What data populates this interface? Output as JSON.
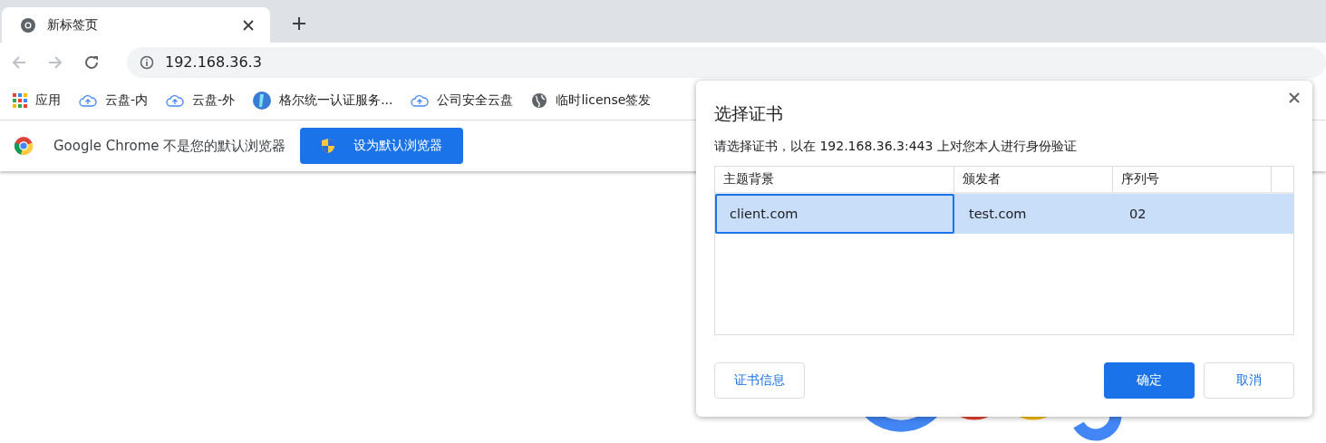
{
  "tabs": [
    {
      "title": "新标签页",
      "selected": true
    }
  ],
  "address_bar": {
    "url": "192.168.36.3"
  },
  "bookmarks": [
    {
      "kind": "apps",
      "label": "应用"
    },
    {
      "kind": "cloud",
      "label": "云盘-内"
    },
    {
      "kind": "cloud",
      "label": "云盘-外"
    },
    {
      "kind": "badge",
      "label": "格尔统一认证服务..."
    },
    {
      "kind": "cloud",
      "label": "公司安全云盘"
    },
    {
      "kind": "globe",
      "label": "临时license签发"
    }
  ],
  "infobar": {
    "message": "Google Chrome 不是您的默认浏览器",
    "button": "设为默认浏览器"
  },
  "dialog": {
    "title": "选择证书",
    "description": "请选择证书，以在 192.168.36.3:443 上对您本人进行身份验证",
    "columns": [
      "主题背景",
      "颁发者",
      "序列号"
    ],
    "rows": [
      {
        "cells": [
          "client.com",
          "test.com",
          "02"
        ],
        "selected": true
      }
    ],
    "buttons": [
      {
        "label": "证书信息",
        "kind": "secondary"
      },
      {
        "label": "确定",
        "kind": "primary"
      },
      {
        "label": "取消",
        "kind": "secondary"
      }
    ]
  }
}
